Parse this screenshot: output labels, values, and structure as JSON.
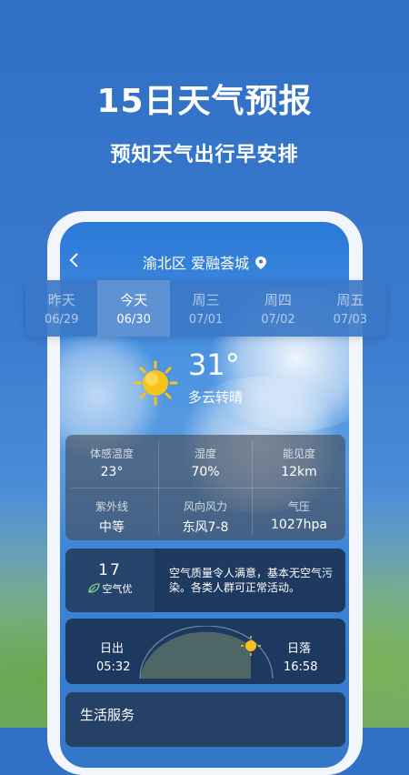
{
  "hero": {
    "title": "15日天气预报",
    "subtitle": "预知天气出行早安排"
  },
  "topbar": {
    "location": "渝北区 爱融荟城"
  },
  "days": [
    {
      "name": "昨天",
      "date": "06/29",
      "active": false
    },
    {
      "name": "今天",
      "date": "06/30",
      "active": true
    },
    {
      "name": "周三",
      "date": "07/01",
      "active": false
    },
    {
      "name": "周四",
      "date": "07/02",
      "active": false
    },
    {
      "name": "周五",
      "date": "07/03",
      "active": false
    }
  ],
  "current": {
    "temp": "31°",
    "condition": "多云转晴"
  },
  "stats": [
    {
      "label": "体感温度",
      "value": "23°"
    },
    {
      "label": "湿度",
      "value": "70%"
    },
    {
      "label": "能见度",
      "value": "12km"
    },
    {
      "label": "紫外线",
      "value": "中等"
    },
    {
      "label": "风向风力",
      "value": "东风7-8"
    },
    {
      "label": "气压",
      "value": "1027hpa"
    }
  ],
  "air": {
    "aqi": "17",
    "level": "空气优",
    "desc": "空气质量令人满意，基本无空气污染。各类人群可正常活动。"
  },
  "sun": {
    "sunrise_label": "日出",
    "sunrise": "05:32",
    "sunset_label": "日落",
    "sunset": "16:58"
  },
  "life": {
    "title": "生活服务"
  },
  "colors": {
    "accent": "#3377c9",
    "sun": "#f7c21c"
  }
}
